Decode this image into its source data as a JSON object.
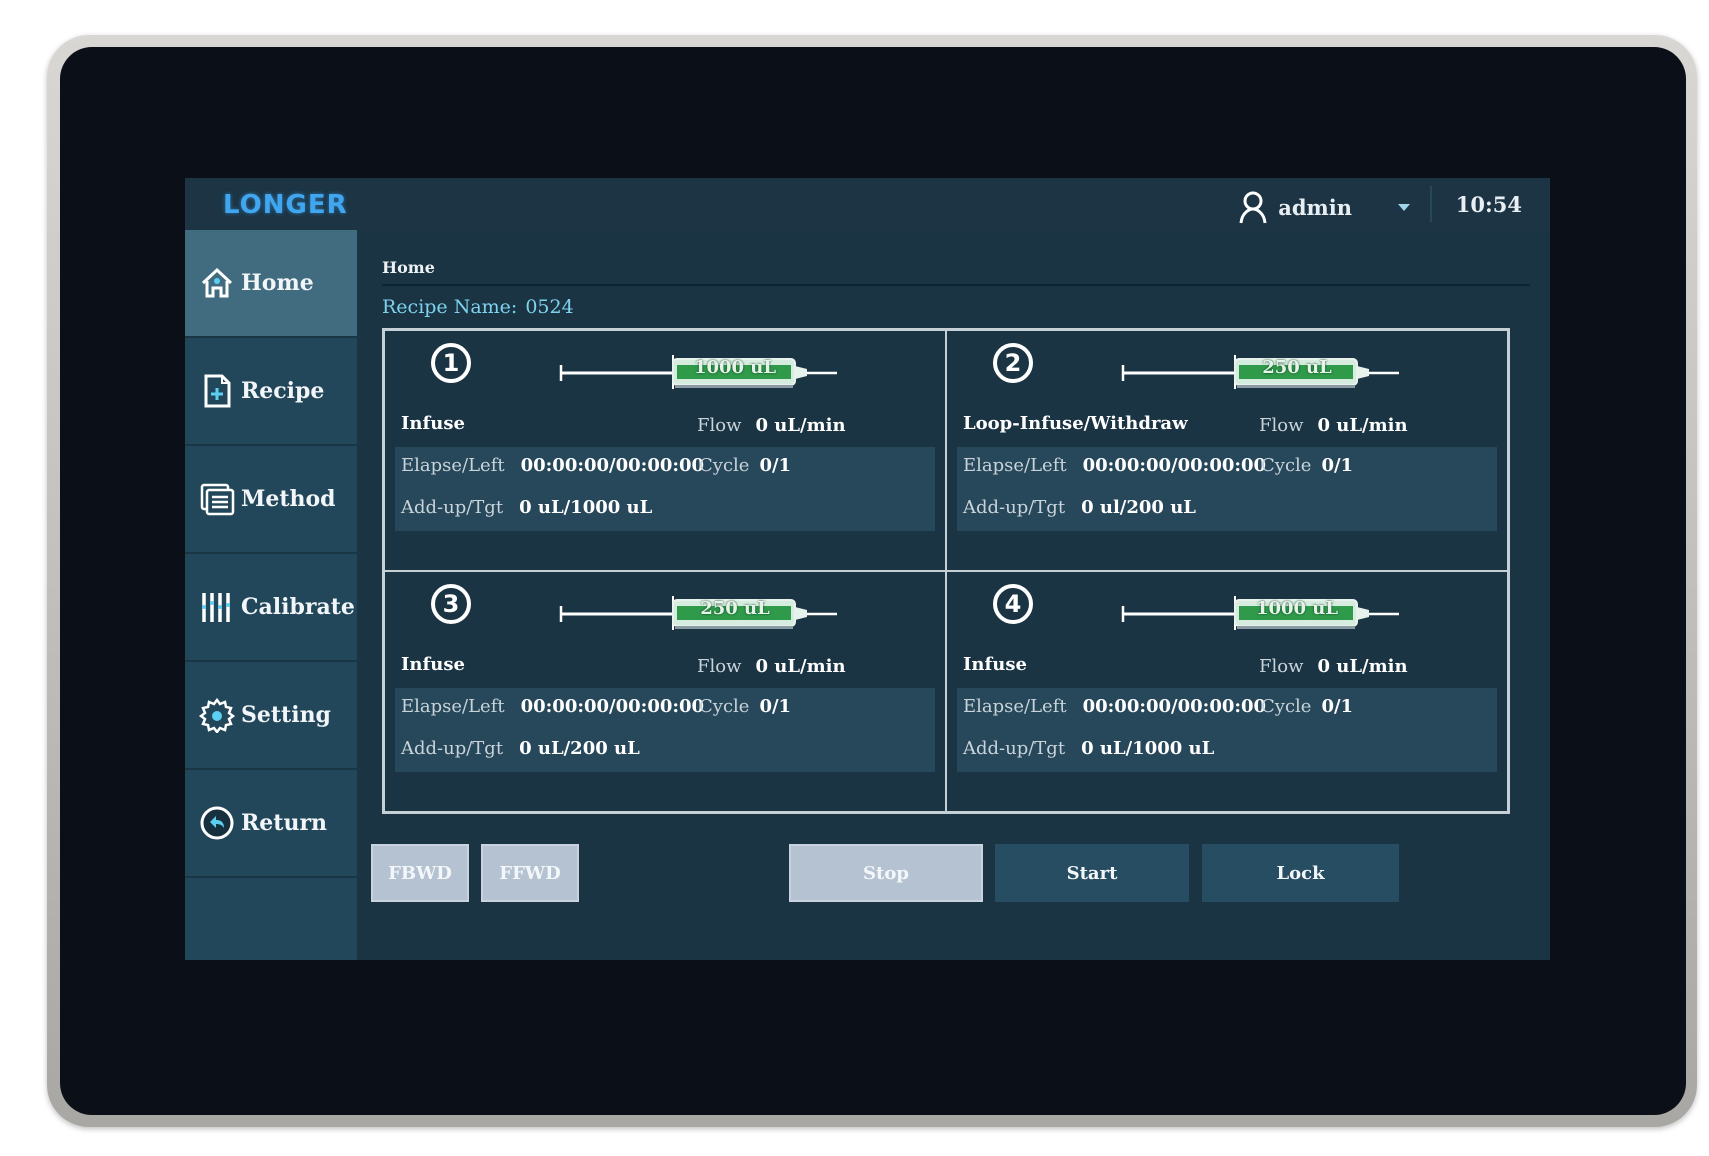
{
  "header": {
    "logo": "LONGER",
    "user": "admin",
    "time": "10:54"
  },
  "sidebar": {
    "items": [
      {
        "label": "Home",
        "icon": "home-icon",
        "active": true
      },
      {
        "label": "Recipe",
        "icon": "recipe-add-icon"
      },
      {
        "label": "Method",
        "icon": "method-list-icon"
      },
      {
        "label": "Calibrate",
        "icon": "calibrate-sliders-icon"
      },
      {
        "label": "Setting",
        "icon": "gear-icon"
      },
      {
        "label": "Return",
        "icon": "return-arrow-icon"
      }
    ]
  },
  "main": {
    "breadcrumb": "Home",
    "recipe_label": "Recipe Name:",
    "recipe_value": "0524",
    "labels": {
      "flow": "Flow",
      "elapse_left": "Elapse/Left",
      "cycle": "Cycle",
      "addup_tgt": "Add-up/Tgt"
    },
    "channels": [
      {
        "number": "1",
        "syringe": "1000 uL",
        "mode": "Infuse",
        "flow": "0 uL/min",
        "elapse_left": "00:00:00/00:00:00",
        "cycle": "0/1",
        "addup_tgt": "0 uL/1000 uL"
      },
      {
        "number": "2",
        "syringe": "250 uL",
        "mode": "Loop-Infuse/Withdraw",
        "flow": "0 uL/min",
        "elapse_left": "00:00:00/00:00:00",
        "cycle": "0/1",
        "addup_tgt": "0 ul/200 uL"
      },
      {
        "number": "3",
        "syringe": "250 uL",
        "mode": "Infuse",
        "flow": "0 uL/min",
        "elapse_left": "00:00:00/00:00:00",
        "cycle": "0/1",
        "addup_tgt": "0 uL/200 uL"
      },
      {
        "number": "4",
        "syringe": "1000 uL",
        "mode": "Infuse",
        "flow": "0 uL/min",
        "elapse_left": "00:00:00/00:00:00",
        "cycle": "0/1",
        "addup_tgt": "0 uL/1000 uL"
      }
    ]
  },
  "buttons": {
    "fbwd": "FBWD",
    "ffwd": "FFWD",
    "stop": "Stop",
    "start": "Start",
    "lock": "Lock"
  },
  "colors": {
    "accent": "#7fd3ef",
    "logo": "#3fa6ef",
    "syringe_fill": "#2f9a4a"
  }
}
